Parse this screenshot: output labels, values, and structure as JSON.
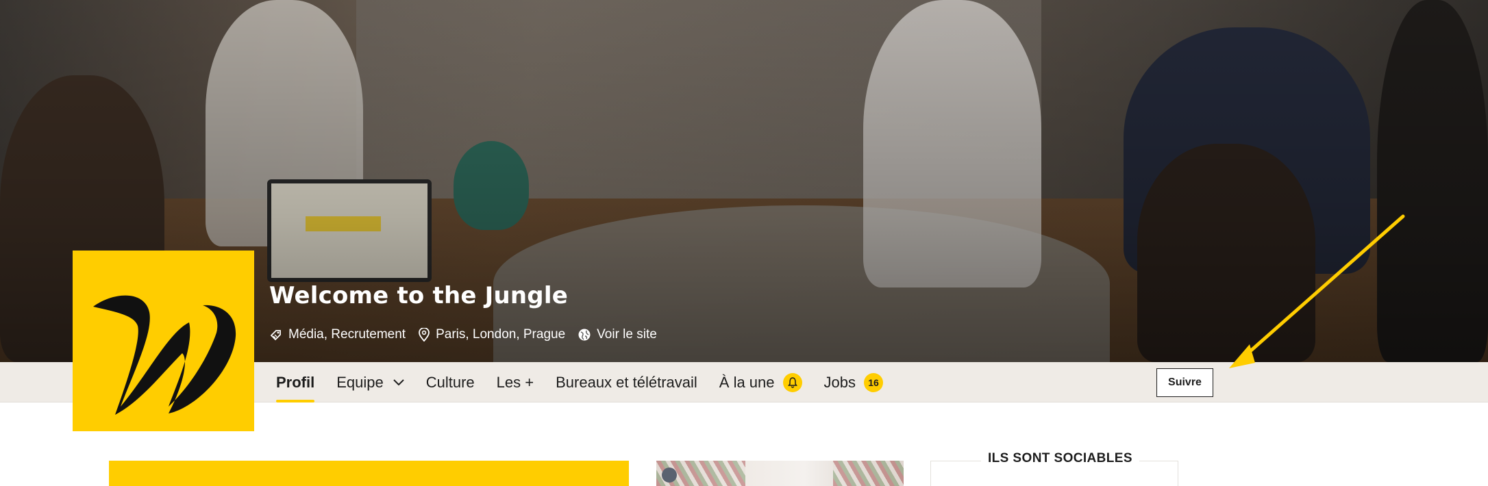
{
  "company": {
    "name": "Welcome to the Jungle",
    "sectors": "Média, Recrutement",
    "locations": "Paris, London, Prague",
    "website_label": "Voir le site"
  },
  "tabs": [
    {
      "label": "Profil",
      "active": true
    },
    {
      "label": "Equipe",
      "has_dropdown": true
    },
    {
      "label": "Culture"
    },
    {
      "label": "Les +"
    },
    {
      "label": "Bureaux et télétravail"
    },
    {
      "label": "À la une",
      "badge_icon": "bell-icon"
    },
    {
      "label": "Jobs",
      "badge": "16"
    }
  ],
  "actions": {
    "follow_label": "Suivre"
  },
  "sidebar": {
    "social_title": "ILS SONT SOCIABLES"
  },
  "colors": {
    "brand_yellow": "#ffcd00",
    "tabbar_bg": "#efebe6",
    "text_dark": "#1c1c1c",
    "arrow": "#ffcd00"
  },
  "icons": {
    "sector": "tag-icon",
    "location": "map-pin-icon",
    "website": "globe-icon",
    "dropdown": "chevron-down-icon",
    "news": "bell-icon"
  }
}
